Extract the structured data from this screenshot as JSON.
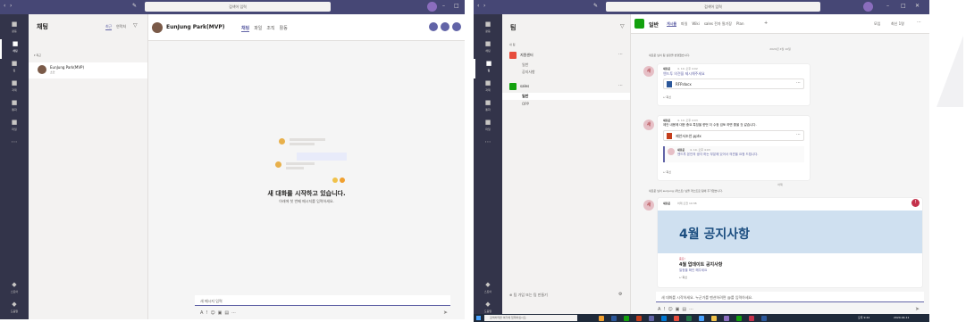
{
  "left": {
    "title_search": "검색어 입력",
    "rail": [
      {
        "icon": "activity-icon",
        "label": "활동"
      },
      {
        "icon": "chat-icon",
        "label": "채팅"
      },
      {
        "icon": "teams-icon",
        "label": "팀"
      },
      {
        "icon": "assignments-icon",
        "label": "과제"
      },
      {
        "icon": "calls-icon",
        "label": "통화"
      },
      {
        "icon": "files-icon",
        "label": "파일"
      }
    ],
    "rail_bottom": [
      {
        "icon": "store-icon",
        "label": "스토어"
      },
      {
        "icon": "help-icon",
        "label": "도움말"
      }
    ],
    "panel_title": "채팅",
    "panel_tab_recent": "최근",
    "panel_tab_contacts": "연락처",
    "recent_label": "최근",
    "chat_item_name": "EunJung Park(MVP)",
    "chat_item_sub": "초안",
    "header_name": "EunJung Park(MVP)",
    "header_tabs": [
      "채팅",
      "파일",
      "조직",
      "활동"
    ],
    "empty_title": "새 대화를 시작하고 있습니다.",
    "empty_sub": "아래에 첫 번째 메시지를 입력하세요.",
    "compose_placeholder": "새 메시지 입력"
  },
  "right": {
    "title_search": "검색어 입력",
    "panel_title": "팀",
    "teams_label": "내 팀",
    "team1": "지원센터",
    "team1_channels": [
      "일반",
      "공지사항"
    ],
    "team2": "sales",
    "team2_channels": [
      "일반",
      "OPP"
    ],
    "join_team": "팀 가입 또는 팀 만들기",
    "channel_name": "일반",
    "channel_tabs": [
      "게시물",
      "파일",
      "Wiki",
      "sales 전자 필기장",
      "Plan"
    ],
    "header_right": [
      "모임",
      "최신 1명"
    ],
    "date_sep": "2020년 4월 10일",
    "sys1": "새로운 님이 팀 설정을 변경했습니다.",
    "msg1_author": "새로운",
    "msg1_time": "4. 10. 오후 4:02",
    "msg1_text": "엔드투 의견을 제시해주세요",
    "msg1_file": "RFP.docx",
    "reply": "회신",
    "msg2_author": "새로운",
    "msg2_time": "4. 10. 오후 4:03",
    "msg2_text": "제안 내용에 대한 중요 특징을 한번 더 수정 검토 하면 좋을 것 같습니다.",
    "msg2_file": "제안서조안.pptx",
    "msg3_author": "새로운",
    "msg3_time": "4. 10. 오후 4:03",
    "msg3_text": "엔드투 본인의 생각 하는 부분에 있어서 의견을 요청 드립니다.",
    "today_sep": "어제",
    "sys2": "새로운 님이 eunjung (게스트) 님을 게스트로 팀에 추가했습니다.",
    "ann_author": "새로운",
    "ann_time": "어제 오전 10:38",
    "ann_banner": "4월 공지사항",
    "ann_badge": "중요!",
    "ann_title": "4월 업데이트 공지사항",
    "ann_sub": "일정을 확인 해주세요",
    "compose_placeholder": "새 대화를 시작하세요. 누군가를 멘션하려면 @를 입력하세요.",
    "taskbar_search": "검색하려면 여기에 입력하십시오.",
    "tray_time": "오후 9:44",
    "tray_date": "2020-04-11"
  },
  "colors": {
    "brand": "#6264a7",
    "titlebar": "#464775",
    "rail": "#33344a",
    "banner": "#cfe0f0",
    "banner_text": "#1c4e80",
    "green": "#13a10e",
    "red": "#c4314b"
  }
}
